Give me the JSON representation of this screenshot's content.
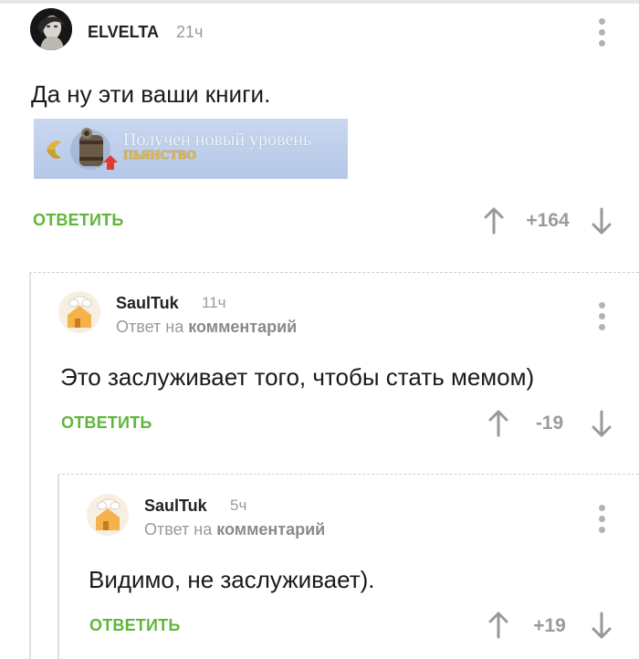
{
  "comments": [
    {
      "author": "ELVELTA",
      "time": "21ч",
      "text": "Да ну эти ваши книги.",
      "reply_label": "ОТВЕТИТЬ",
      "rating": "+164",
      "badge": {
        "line1": "Получен новый уровень",
        "line2": "ПЬЯНСТВО"
      }
    },
    {
      "author": "SaulTuk",
      "time": "11ч",
      "reply_prefix": "Ответ на",
      "reply_target": "комментарий",
      "text": "Это заслуживает того, чтобы стать мемом)",
      "reply_label": "ОТВЕТИТЬ",
      "rating": "-19"
    },
    {
      "author": "SaulTuk",
      "time": "5ч",
      "reply_prefix": "Ответ на",
      "reply_target": "комментарий",
      "text": "Видимо, не заслуживает).",
      "reply_label": "ОТВЕТИТЬ",
      "rating": "+19"
    }
  ],
  "colors": {
    "reply_button": "#5fb63b",
    "rating": "#9a9a9a",
    "thread_line": "#e0e0e0"
  },
  "icons": {
    "more": "more-vertical-icon",
    "upvote": "arrow-up-icon",
    "downvote": "arrow-down-icon"
  }
}
